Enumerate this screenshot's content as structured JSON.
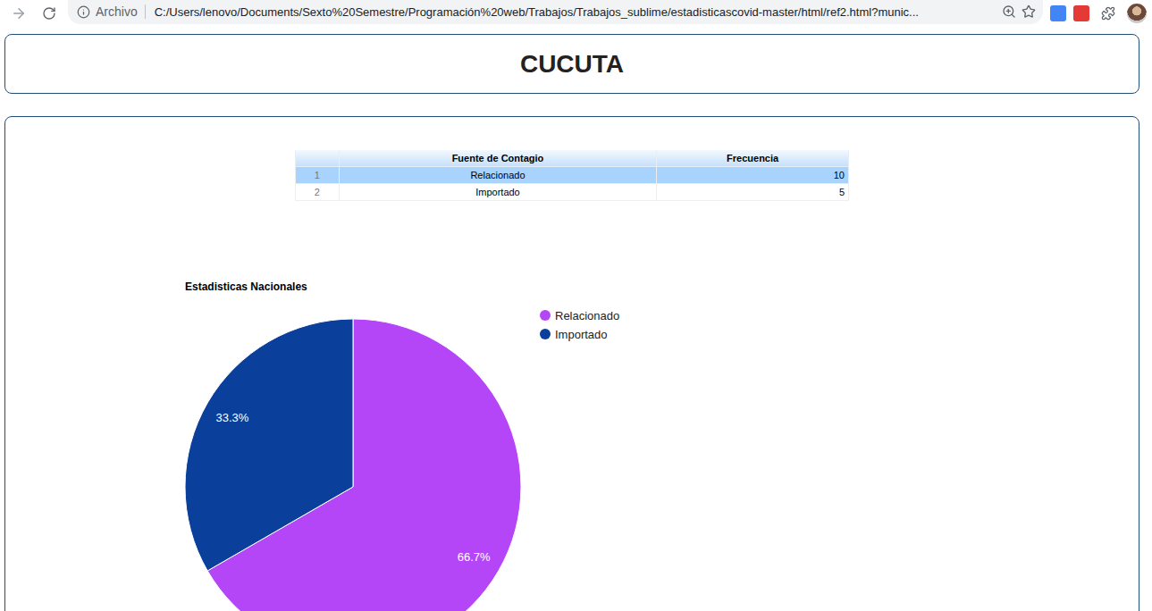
{
  "browser": {
    "origin_label": "Archivo",
    "url": "C:/Users/lenovo/Documents/Sexto%20Semestre/Programación%20web/Trabajos/Trabajos_sublime/estadisticascovid-master/html/ref2.html?munic..."
  },
  "header": {
    "title": "CUCUTA"
  },
  "table": {
    "columns": [
      "",
      "Fuente de Contagio",
      "Frecuencia"
    ],
    "rows": [
      {
        "index": "1",
        "source": "Relacionado",
        "count": "10",
        "selected": true
      },
      {
        "index": "2",
        "source": "Importado",
        "count": "5",
        "selected": false
      }
    ]
  },
  "chart": {
    "title": "Estadisticas Nacionales",
    "slices": [
      {
        "label": "Relacionado",
        "value": 10,
        "percent": "66.7%",
        "color": "#b546f8"
      },
      {
        "label": "Importado",
        "value": 5,
        "percent": "33.3%",
        "color": "#0a3f9c"
      }
    ]
  }
}
